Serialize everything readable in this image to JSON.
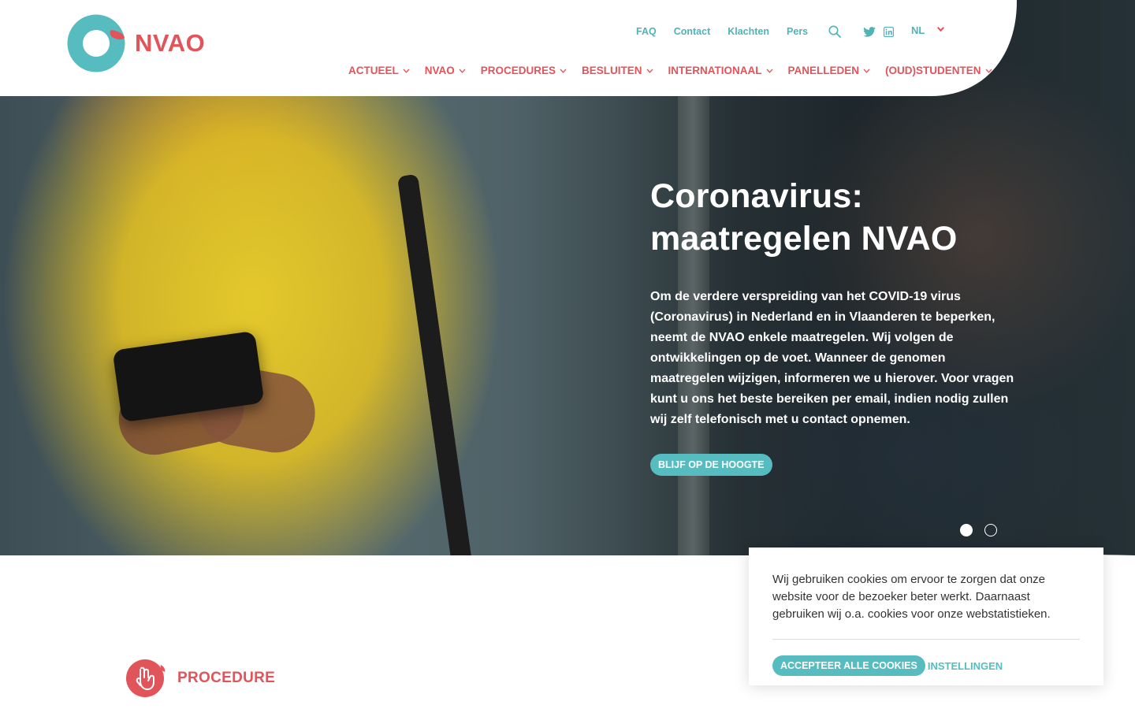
{
  "brand": {
    "name": "NVAO",
    "color_primary": "#e0545a",
    "color_accent": "#56bcc0"
  },
  "utility_nav": {
    "links": [
      "FAQ",
      "Contact",
      "Klachten",
      "Pers"
    ],
    "icons": [
      "search-icon",
      "twitter-icon",
      "linkedin-icon"
    ],
    "language": "NL"
  },
  "main_nav": {
    "items": [
      "ACTUEEL",
      "NVAO",
      "PROCEDURES",
      "BESLUITEN",
      "INTERNATIONAAL",
      "PANELLEDEN",
      "(OUD)STUDENTEN"
    ]
  },
  "hero": {
    "title": "Coronavirus: maatregelen NVAO",
    "text": "Om de verdere verspreiding van het COVID-19 virus (Coronavirus) in Nederland en in Vlaanderen te beperken, neemt de NVAO enkele maatregelen. Wij volgen de ontwikkelingen op de voet. Wanneer de genomen maatregelen wijzigen, informeren we u hierover. Voor vragen kunt u ons het beste bereiken per email, indien nodig zullen wij zelf telefonisch met u contact opnemen.",
    "button": "BLIJF OP DE HOOGTE",
    "slides": 2,
    "active_slide": 1
  },
  "cookie": {
    "text": "Wij gebruiken cookies om ervoor te zorgen dat onze website voor de bezoeker beter werkt. Daarnaast gebruiken wij o.a. cookies voor onze webstatistieken.",
    "accept": "ACCEPTEER ALLE COOKIES",
    "settings": "INSTELLINGEN"
  },
  "section": {
    "label": "PROCEDURE",
    "icon": "hand-icon"
  }
}
